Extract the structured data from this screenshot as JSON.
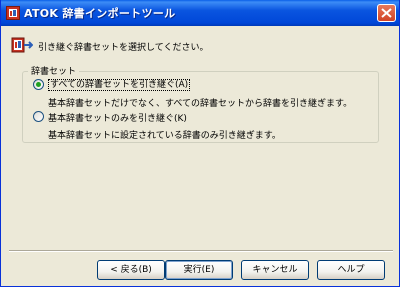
{
  "window": {
    "title": "ATOK 辞書インポートツール",
    "icons": {
      "app": "dictionary-app-icon",
      "close": "close-icon"
    }
  },
  "prompt": {
    "icon": "dictionary-import-icon",
    "text": "引き継ぐ辞書セットを選択してください。"
  },
  "group": {
    "title": "辞書セット",
    "options": [
      {
        "label": "すべての辞書セットを引き継ぐ(A)",
        "selected": true,
        "description": "基本辞書セットだけでなく、すべての辞書セットから辞書を引き継ぎます。"
      },
      {
        "label": "基本辞書セットのみを引き継ぐ(K)",
        "selected": false,
        "description": "基本辞書セットに設定されている辞書のみ引き継ぎます。"
      }
    ]
  },
  "buttons": {
    "back": "< 戻る(B)",
    "run": "実行(E)",
    "cancel": "キャンセル",
    "help": "ヘルプ"
  },
  "colors": {
    "titlebar": "#0a55e0",
    "dialog_bg": "#ece9d8",
    "close_button": "#d14326",
    "radio_dot": "#21a121"
  }
}
